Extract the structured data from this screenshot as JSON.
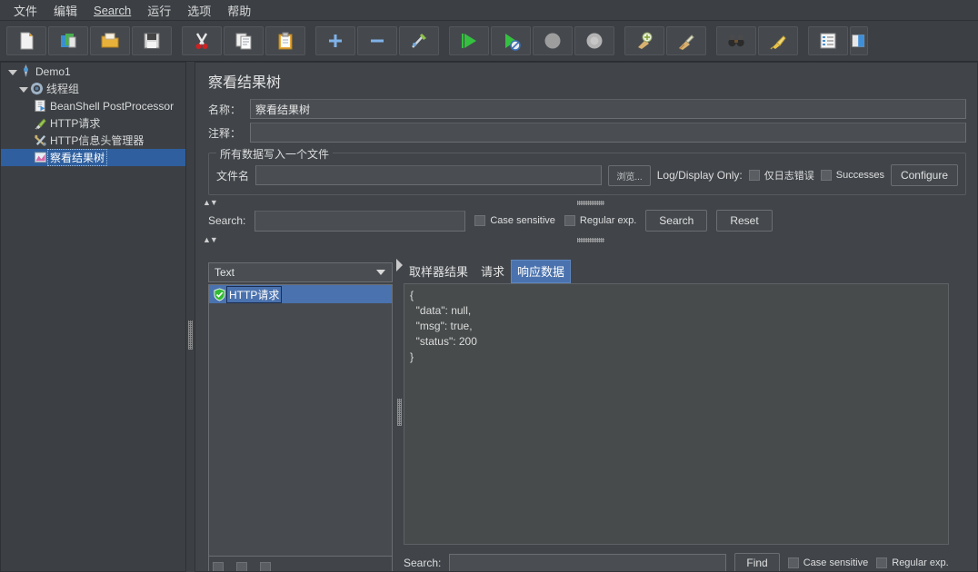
{
  "window": {
    "menu": [
      {
        "label": "文件",
        "underline": false
      },
      {
        "label": "编辑",
        "underline": false
      },
      {
        "label": "Search",
        "underline": true
      },
      {
        "label": "运行",
        "underline": false
      },
      {
        "label": "选项",
        "underline": false
      },
      {
        "label": "帮助",
        "underline": false
      }
    ]
  },
  "toolbar": {
    "buttons": [
      {
        "name": "new-icon",
        "title": "New"
      },
      {
        "name": "templates-icon",
        "title": "Templates"
      },
      {
        "name": "open-icon",
        "title": "Open"
      },
      {
        "name": "save-icon",
        "title": "Save"
      },
      {
        "name": "cut-icon",
        "title": "Cut"
      },
      {
        "name": "copy-icon",
        "title": "Copy"
      },
      {
        "name": "paste-icon",
        "title": "Paste"
      },
      {
        "name": "expand-all-icon",
        "title": "Expand All"
      },
      {
        "name": "collapse-all-icon",
        "title": "Collapse All"
      },
      {
        "name": "toggle-icon",
        "title": "Toggle"
      },
      {
        "name": "start-icon",
        "title": "Start"
      },
      {
        "name": "start-no-pauses-icon",
        "title": "Start no pauses"
      },
      {
        "name": "stop-icon",
        "title": "Stop"
      },
      {
        "name": "shutdown-icon",
        "title": "Shutdown"
      },
      {
        "name": "clear-icon",
        "title": "Clear"
      },
      {
        "name": "clear-all-icon",
        "title": "Clear All"
      },
      {
        "name": "search-icon",
        "title": "Search"
      },
      {
        "name": "search-reset-icon",
        "title": "Reset Search"
      },
      {
        "name": "function-helper-icon",
        "title": "Function Helper"
      },
      {
        "name": "log-viewer-icon",
        "title": "Log Viewer"
      }
    ]
  },
  "tree": {
    "nodes": [
      {
        "label": "Demo1",
        "depth": 0,
        "icon": "test-plan-icon",
        "expanded": true,
        "selected": false
      },
      {
        "label": "线程组",
        "depth": 1,
        "icon": "thread-group-icon",
        "expanded": true,
        "selected": false
      },
      {
        "label": "BeanShell PostProcessor",
        "depth": 2,
        "icon": "beanshell-icon",
        "expanded": false,
        "selected": false
      },
      {
        "label": "HTTP请求",
        "depth": 2,
        "icon": "http-sampler-icon",
        "expanded": false,
        "selected": false
      },
      {
        "label": "HTTP信息头管理器",
        "depth": 2,
        "icon": "header-manager-icon",
        "expanded": false,
        "selected": false
      },
      {
        "label": "察看结果树",
        "depth": 2,
        "icon": "view-results-tree-icon",
        "expanded": false,
        "selected": true
      }
    ]
  },
  "main": {
    "title": "察看结果树",
    "name_label": "名称：",
    "name_value": "察看结果树",
    "comment_label": "注释：",
    "comment_value": "",
    "filegroup": {
      "title": "所有数据写入一个文件",
      "filename_label": "文件名",
      "filename_value": "",
      "browse_label": "浏览...",
      "log_display_only_label": "Log/Display Only:",
      "errors_only_label": "仅日志错误",
      "errors_only_checked": false,
      "successes_label": "Successes",
      "successes_checked": false,
      "configure_label": "Configure"
    },
    "search": {
      "label": "Search:",
      "value": "",
      "case_sensitive_label": "Case sensitive",
      "case_sensitive_checked": false,
      "regular_exp_label": "Regular exp.",
      "regular_exp_checked": false,
      "search_button": "Search",
      "reset_button": "Reset"
    },
    "results": {
      "renderer_selected": "Text",
      "entries": [
        {
          "label": "HTTP请求",
          "status": "success",
          "selected": true
        }
      ],
      "tabs": [
        {
          "label": "取样器结果",
          "active": false
        },
        {
          "label": "请求",
          "active": false
        },
        {
          "label": "响应数据",
          "active": true
        }
      ],
      "response_body": "{\n  \"data\": null,\n  \"msg\": true,\n  \"status\": 200\n}",
      "bottom_search": {
        "label": "Search:",
        "value": "",
        "find_button": "Find",
        "case_sensitive_label": "Case sensitive",
        "case_sensitive_checked": false,
        "regular_exp_label": "Regular exp.",
        "regular_exp_checked": false
      }
    }
  },
  "colors": {
    "window_bg": "#3c4045",
    "panel_bg": "#41454a",
    "selection_blue": "#2f5f9e",
    "tab_active_blue": "#4a72ae",
    "field_bg": "#4a4e53",
    "text": "#dcdcdc"
  }
}
